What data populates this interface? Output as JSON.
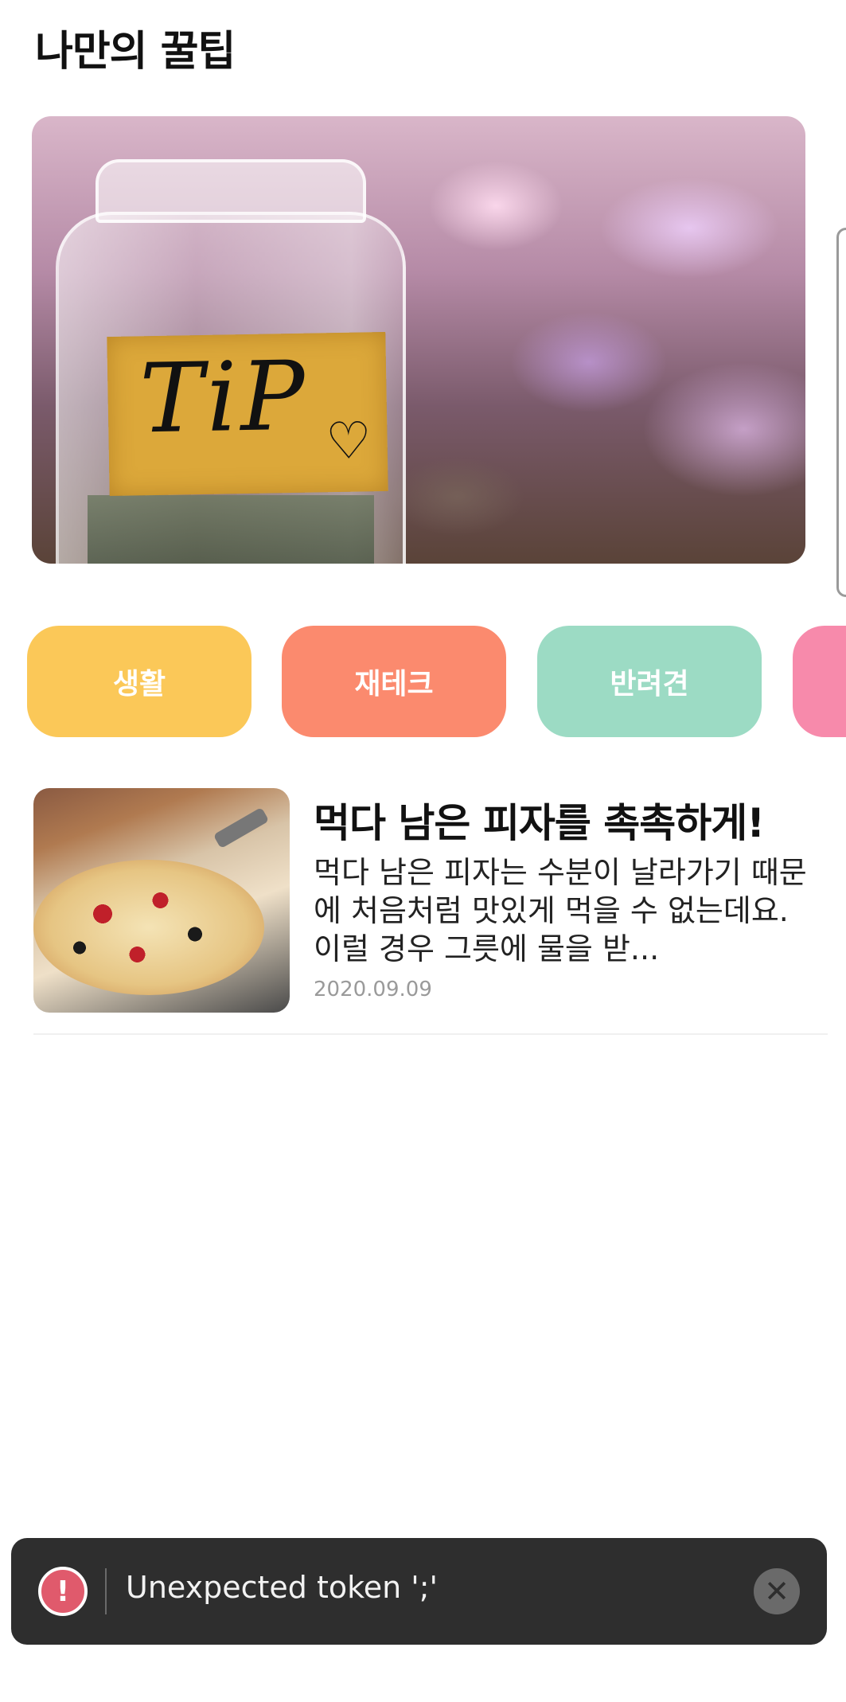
{
  "header": {
    "title": "나만의 꿀팁"
  },
  "hero": {
    "label_text": "TiP",
    "icon": "heart-icon"
  },
  "categories": [
    {
      "label": "생활",
      "color": "#fbc858"
    },
    {
      "label": "재테크",
      "color": "#fb8a6e"
    },
    {
      "label": "반려견",
      "color": "#9cdbc4"
    },
    {
      "label": "",
      "color": "#f78aab"
    }
  ],
  "articles": [
    {
      "title": "먹다 남은 피자를 촉촉하게!",
      "body": "먹다 남은 피자는 수분이 날라가기 때문에 처음처럼 맛있게 먹을 수 없는데요. 이럴 경우 그릇에 물을 받...",
      "date": "2020.09.09"
    }
  ],
  "toast": {
    "message": "Unexpected token ';'",
    "icon": "error-icon",
    "close_icon": "close-icon",
    "error_color": "#e05a6c"
  }
}
